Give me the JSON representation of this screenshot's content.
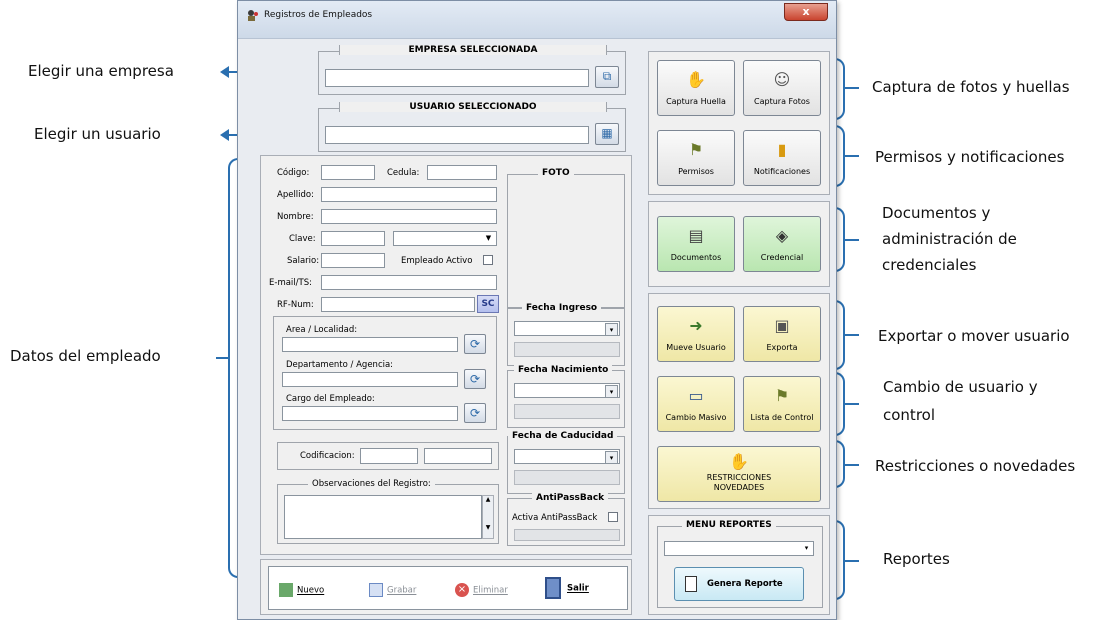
{
  "window": {
    "title": "Registros de Empleados",
    "close_label": "x"
  },
  "callouts": {
    "left": {
      "empresa": "Elegir una empresa",
      "usuario": "Elegir un usuario",
      "datos": "Datos del empleado"
    },
    "right": {
      "captura": "Captura de fotos y huellas",
      "permisos": "Permisos y notificaciones",
      "documentos_1": "Documentos y",
      "documentos_2": "administración de",
      "documentos_3": "credenciales",
      "exportar": "Exportar o mover usuario",
      "cambio_1": "Cambio de usuario y",
      "cambio_2": "control",
      "restricciones": "Restricciones o novedades",
      "reportes": "Reportes"
    }
  },
  "empresa": {
    "group_label": "EMPRESA SELECCIONADA",
    "value": ""
  },
  "usuario": {
    "group_label": "USUARIO SELECCIONADO",
    "value": ""
  },
  "form": {
    "codigo_label": "Código:",
    "cedula_label": "Cedula:",
    "apellido_label": "Apellido:",
    "nombre_label": "Nombre:",
    "clave_label": "Clave:",
    "salario_label": "Salario:",
    "empleado_activo_label": "Empleado Activo",
    "email_label": "E-mail/TS:",
    "rfnum_label": "RF-Num:",
    "sc_label": "SC",
    "area_label": "Area / Localidad:",
    "departamento_label": "Departamento / Agencia:",
    "cargo_label": "Cargo del Empleado:",
    "codificacion_label": "Codificacion:",
    "observaciones_label": "Observaciones del Registro:"
  },
  "right_form": {
    "foto_label": "FOTO",
    "fecha_ingreso_label": "Fecha Ingreso",
    "fecha_nacimiento_label": "Fecha Nacimiento",
    "fecha_caducidad_label": "Fecha de Caducidad",
    "antipassback_label": "AntiPassBack",
    "activa_antipassback_label": "Activa AntiPassBack"
  },
  "toolbar": {
    "nuevo": "Nuevo",
    "grabar": "Grabar",
    "eliminar": "Eliminar",
    "salir": "Salir"
  },
  "side_buttons": {
    "captura_huella": "Captura Huella",
    "captura_fotos": "Captura Fotos",
    "permisos": "Permisos",
    "notificaciones": "Notificaciones",
    "documentos": "Documentos",
    "credencial": "Credencial",
    "mueve_usuario": "Mueve Usuario",
    "exporta": "Exporta",
    "cambio_masivo": "Cambio Masivo",
    "lista_control": "Lista de Control",
    "restricciones_1": "RESTRICCIONES",
    "restricciones_2": "NOVEDADES"
  },
  "reportes": {
    "group_label": "MENU REPORTES",
    "selected": "",
    "genera_label": "Genera Reporte"
  }
}
